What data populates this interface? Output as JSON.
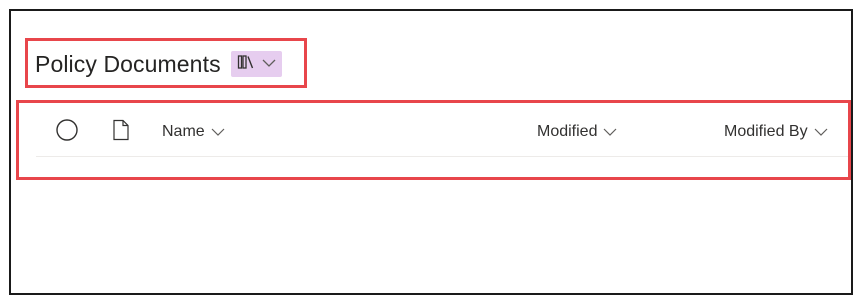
{
  "library": {
    "title": "Policy Documents",
    "view_switch_icon": "library-icon",
    "view_switch_chevron": "chevron-down-icon"
  },
  "list_header": {
    "select_all_icon": "circle-checkbox-icon",
    "file_type_icon": "document-icon",
    "columns": [
      {
        "label": "Name",
        "icon": "chevron-down-icon"
      },
      {
        "label": "Modified",
        "icon": "chevron-down-icon"
      },
      {
        "label": "Modified By",
        "icon": "chevron-down-icon"
      }
    ]
  },
  "colors": {
    "highlight_border": "#e8464b",
    "view_switch_bg": "#e6cdef",
    "text": "#252423",
    "divider": "#edebe9"
  }
}
